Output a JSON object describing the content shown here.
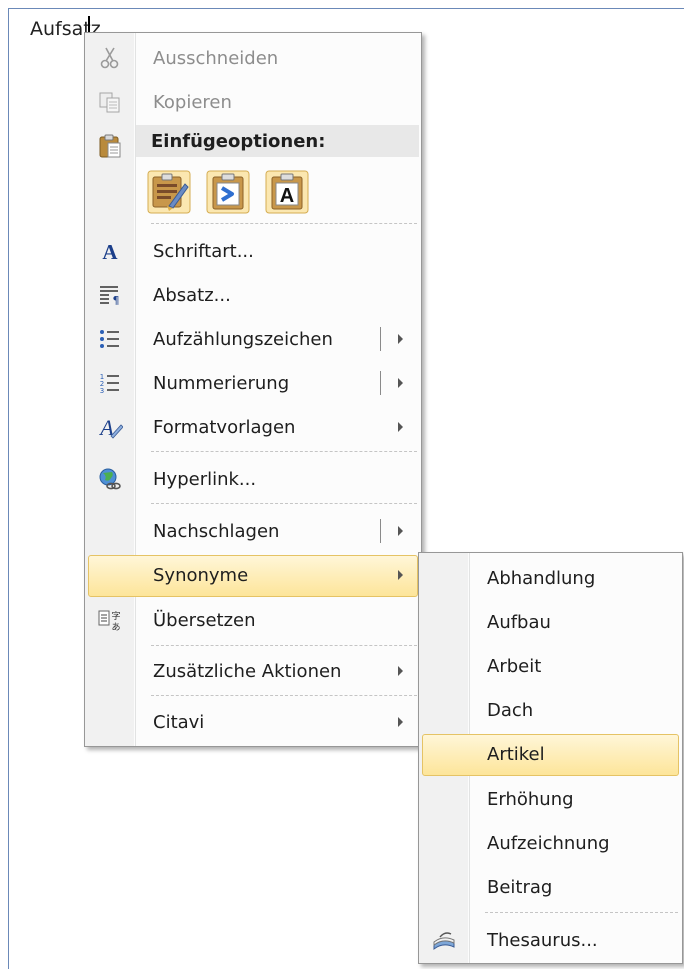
{
  "document": {
    "word": "Aufsatz"
  },
  "context_menu": {
    "cut": "Ausschneiden",
    "copy": "Kopieren",
    "paste_options_header": "Einfügeoptionen:",
    "paste_options": [
      {
        "icon": "paste-keep-formatting-icon"
      },
      {
        "icon": "paste-merge-formatting-icon"
      },
      {
        "icon": "paste-text-only-icon",
        "glyph": "A"
      }
    ],
    "font": "Schriftart...",
    "paragraph": "Absatz...",
    "bullets": "Aufzählungszeichen",
    "numbering": "Nummerierung",
    "styles": "Formatvorlagen",
    "hyperlink": "Hyperlink...",
    "lookup": "Nachschlagen",
    "synonyms": "Synonyme",
    "translate": "Übersetzen",
    "additional_actions": "Zusätzliche Aktionen",
    "citavi": "Citavi"
  },
  "synonyms_submenu": {
    "items": [
      "Abhandlung",
      "Aufbau",
      "Arbeit",
      "Dach",
      "Artikel",
      "Erhöhung",
      "Aufzeichnung",
      "Beitrag"
    ],
    "highlighted": "Artikel",
    "thesaurus": "Thesaurus..."
  },
  "colors": {
    "highlight_border": "#e5c365",
    "highlight_fill": "#fde59a",
    "menu_bg": "#fcfcfc",
    "doc_border": "#6b89b8"
  }
}
